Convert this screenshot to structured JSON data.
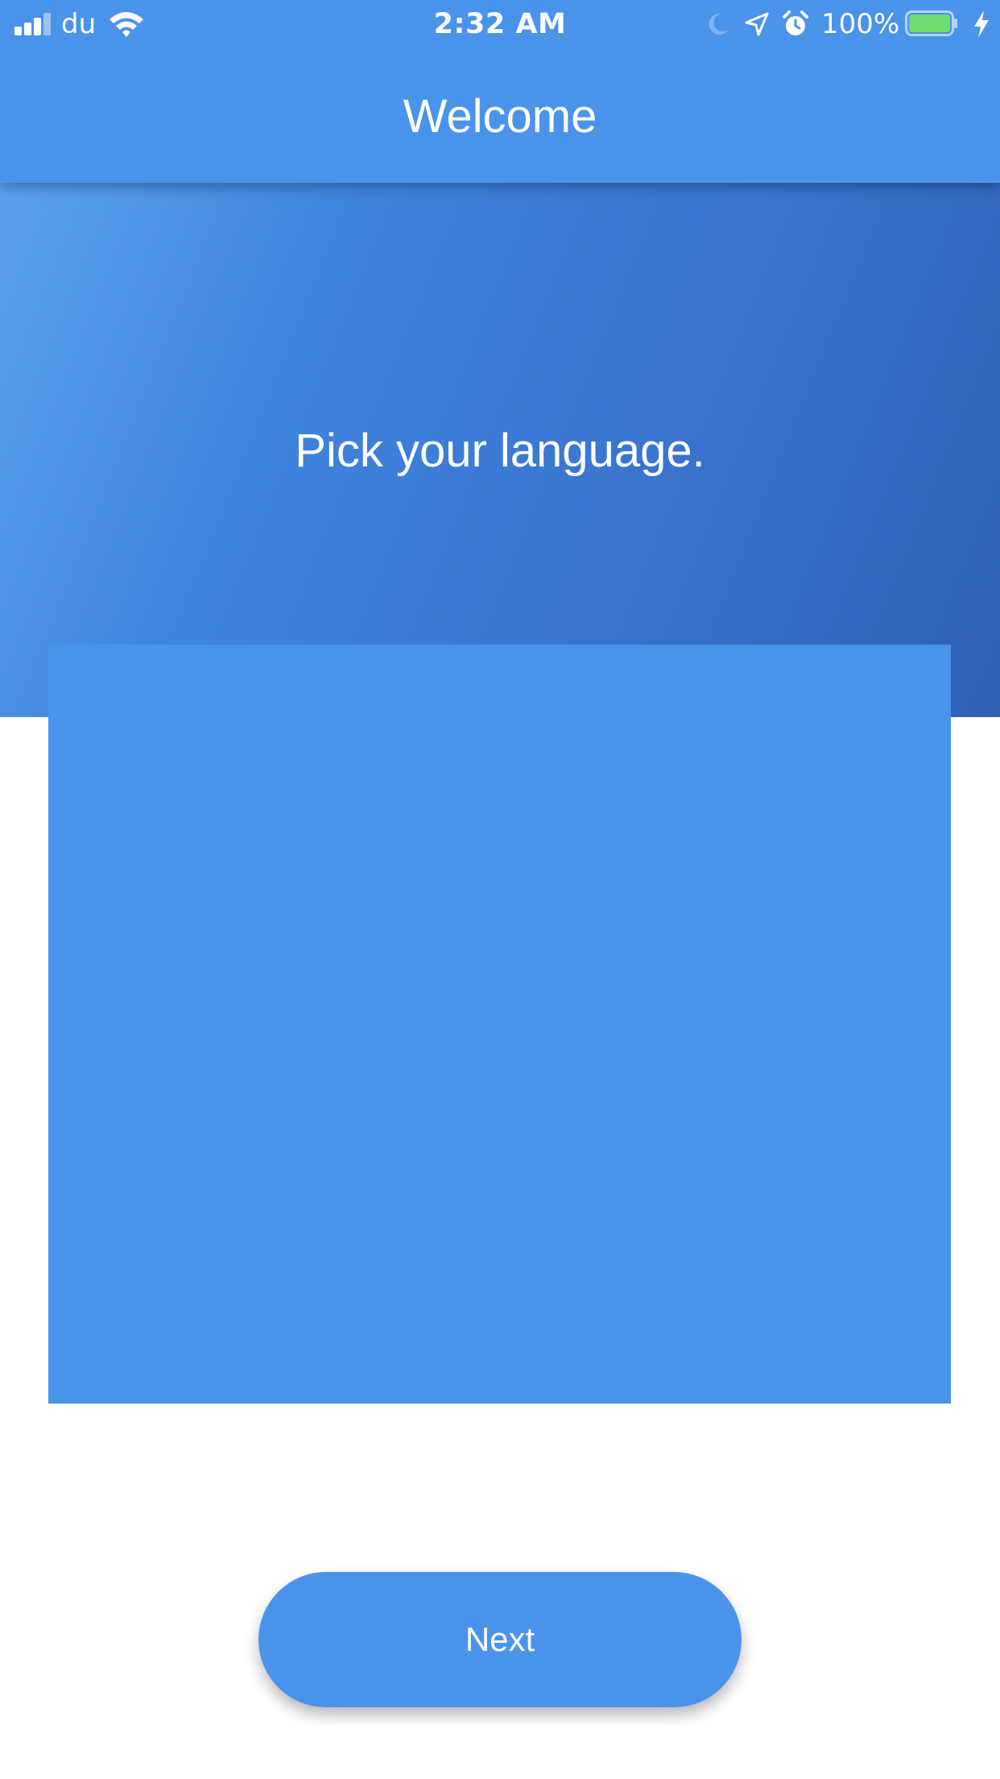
{
  "status_bar": {
    "carrier": "du",
    "time": "2:32 AM",
    "battery_percent": "100%",
    "battery_level": 1.0,
    "battery_color": "#6fdc6f",
    "icons": [
      "signal-icon",
      "wifi-icon",
      "moon-icon",
      "location-arrow-icon",
      "alarm-icon",
      "battery-icon",
      "charging-bolt-icon"
    ]
  },
  "nav": {
    "title": "Welcome"
  },
  "hero": {
    "prompt": "Pick your language."
  },
  "footer": {
    "next_label": "Next"
  },
  "colors": {
    "primary": "#4a93ea",
    "gradient_start": "#5aa0ee",
    "gradient_end": "#2f60b6",
    "background": "#ffffff"
  }
}
